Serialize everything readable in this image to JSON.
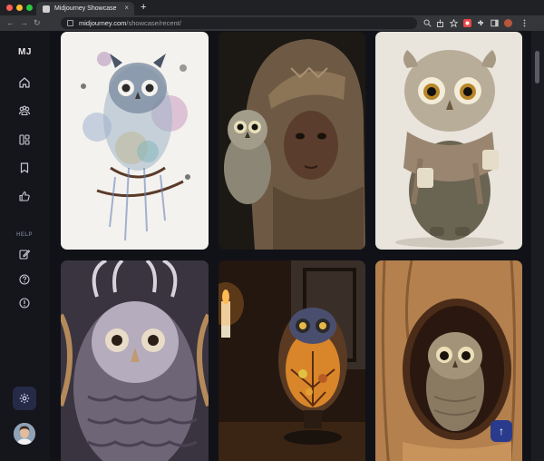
{
  "browser": {
    "tab_title": "Midjourney Showcase",
    "tab_close": "×",
    "new_tab": "+",
    "url_domain": "midjourney.com",
    "url_path": "/showcase/recent/",
    "nav": {
      "back": "←",
      "forward": "→",
      "reload": "↻"
    }
  },
  "sidebar": {
    "logo": "MJ",
    "items": [
      {
        "name": "home",
        "icon": "home-icon"
      },
      {
        "name": "community",
        "icon": "community-icon"
      },
      {
        "name": "gallery",
        "icon": "gallery-icon"
      },
      {
        "name": "bookmarks",
        "icon": "bookmark-icon"
      },
      {
        "name": "likes",
        "icon": "thumbs-up-icon"
      }
    ],
    "help_label": "HELP",
    "help_items": [
      {
        "name": "edit",
        "icon": "edit-icon"
      },
      {
        "name": "help",
        "icon": "question-icon"
      },
      {
        "name": "info",
        "icon": "info-icon"
      }
    ],
    "settings_icon": "gear-icon"
  },
  "gallery": {
    "images": [
      {
        "subject": "watercolor-owl",
        "icon": "owl-image"
      },
      {
        "subject": "hooded-child-with-owl",
        "icon": "portrait-image"
      },
      {
        "subject": "owl-with-scarf-and-mug",
        "icon": "owl-image"
      },
      {
        "subject": "ornate-feathered-owl",
        "icon": "owl-image"
      },
      {
        "subject": "stained-glass-owl-lamp",
        "icon": "lamp-image"
      },
      {
        "subject": "owl-in-tree-hollow",
        "icon": "owl-image"
      }
    ],
    "scroll_to_top": "↑"
  },
  "colors": {
    "accent": "#2a3a8c",
    "sidebar": "#15151c",
    "background": "#111118"
  }
}
